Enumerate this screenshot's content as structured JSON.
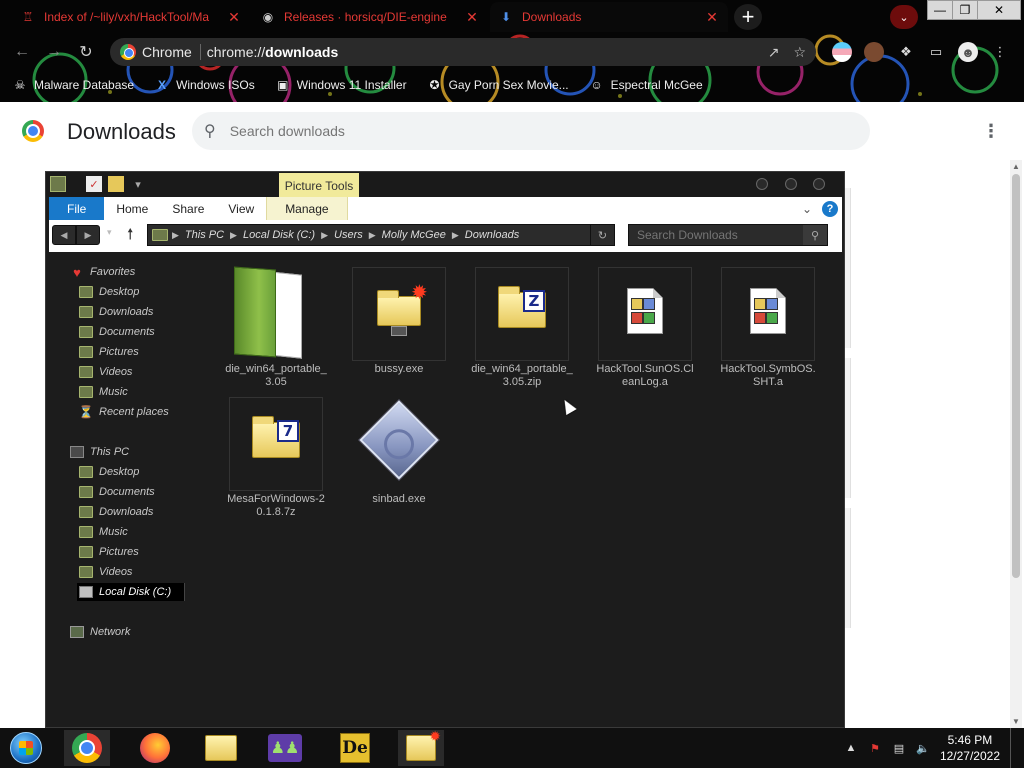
{
  "browser": {
    "tabs": [
      {
        "title": "Index of /~lily/vxh/HackTool/Ma",
        "favicon": "hat-icon"
      },
      {
        "title": "Releases · horsicq/DIE-engine",
        "favicon": "github-icon"
      },
      {
        "title": "Downloads",
        "favicon": "download-icon",
        "active": true
      }
    ],
    "omnibox": {
      "chip_label": "Chrome",
      "url_scheme": "chrome://",
      "url_host": "downloads"
    },
    "bookmarks": [
      {
        "label": "Malware Database",
        "icon": "skull-icon"
      },
      {
        "label": "Windows ISOs",
        "icon": "x-logo-icon"
      },
      {
        "label": "Windows 11 Installer",
        "icon": "image-icon"
      },
      {
        "label": "Gay Porn Sex Movie...",
        "icon": "badge-icon"
      },
      {
        "label": "Espectral McGee",
        "icon": "face-icon"
      }
    ]
  },
  "downloads_page": {
    "title": "Downloads",
    "search_placeholder": "Search downloads"
  },
  "explorer": {
    "contextual_tab": "Picture Tools",
    "ribbon_tabs": [
      "File",
      "Home",
      "Share",
      "View",
      "Manage"
    ],
    "breadcrumb": [
      "This PC",
      "Local Disk (C:)",
      "Users",
      "Molly McGee",
      "Downloads"
    ],
    "search_placeholder": "Search Downloads",
    "nav": {
      "favorites_label": "Favorites",
      "favorites": [
        "Desktop",
        "Downloads",
        "Documents",
        "Pictures",
        "Videos",
        "Music",
        "Recent places"
      ],
      "this_pc_label": "This PC",
      "this_pc": [
        "Desktop",
        "Documents",
        "Downloads",
        "Music",
        "Pictures",
        "Videos",
        "Local Disk (C:)"
      ],
      "network_label": "Network"
    },
    "files": [
      {
        "name": "die_win64_portable_3.05",
        "kind": "folder"
      },
      {
        "name": "bussy.exe",
        "kind": "exe-folder"
      },
      {
        "name": "die_win64_portable_3.05.zip",
        "kind": "zip"
      },
      {
        "name": "HackTool.SunOS.CleanLog.a",
        "kind": "unknown"
      },
      {
        "name": "HackTool.SymbOS.SHT.a",
        "kind": "unknown"
      },
      {
        "name": "MesaForWindows-20.1.8.7z",
        "kind": "7z"
      },
      {
        "name": "sinbad.exe",
        "kind": "exe"
      }
    ]
  },
  "taskbar": {
    "time": "5:46 PM",
    "date": "12/27/2022"
  },
  "colors": {
    "tab_text": "#e53935",
    "file_tab": "#1979ca",
    "picture_tools": "#f1ea9b"
  }
}
